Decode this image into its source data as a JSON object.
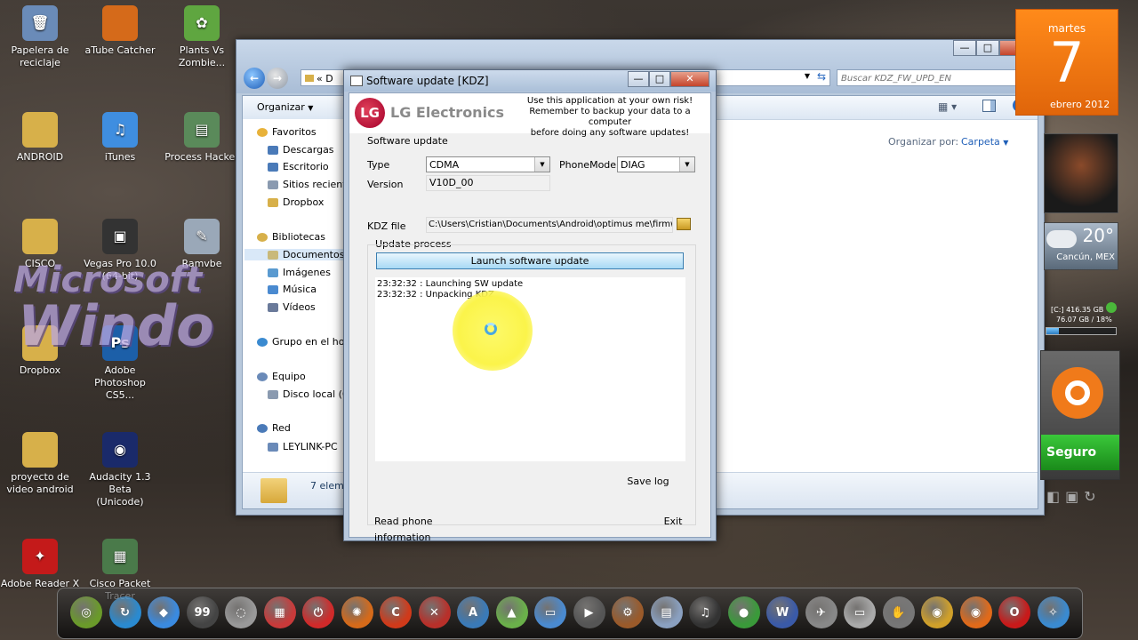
{
  "desktop": {
    "icons": [
      {
        "label": "Papelera de\nreciclaje",
        "glyph": "🗑",
        "color": "#6a8bb8"
      },
      {
        "label": "aTube Catcher",
        "glyph": "",
        "color": "#d56a1a"
      },
      {
        "label": "Plants Vs\nZombie...",
        "glyph": "✿",
        "color": "#5fa640"
      },
      {
        "label": "ANDROID",
        "glyph": "",
        "color": "#d7b04a"
      },
      {
        "label": "iTunes",
        "glyph": "♫",
        "color": "#3f8ee0"
      },
      {
        "label": "Process Hacker",
        "glyph": "▤",
        "color": "#5a8a5a"
      },
      {
        "label": "CISCO",
        "glyph": "",
        "color": "#d7b04a"
      },
      {
        "label": "Vegas Pro 10.0\n(64-bit)",
        "glyph": "▣",
        "color": "#333"
      },
      {
        "label": "Ramvbe",
        "glyph": "✎",
        "color": "#9aa8b8"
      },
      {
        "label": "Dropbox",
        "glyph": "",
        "color": "#d7b04a"
      },
      {
        "label": "Adobe\nPhotoshop CS5...",
        "glyph": "Ps",
        "color": "#1c5fa8"
      },
      {
        "label": "proyecto de\nvideo android",
        "glyph": "",
        "color": "#d7b04a"
      },
      {
        "label": "Audacity 1.3 Beta\n(Unicode)",
        "glyph": "◉",
        "color": "#1a2a6a"
      },
      {
        "label": "Adobe Reader X",
        "glyph": "✦",
        "color": "#c41a1a"
      },
      {
        "label": "Cisco Packet\nTracer",
        "glyph": "▦",
        "color": "#4a7a4a"
      }
    ],
    "watermark_1": "Microsoft",
    "watermark_2": "Windo"
  },
  "explorer": {
    "address_crumb": "« D",
    "search_placeholder": "Buscar KDZ_FW_UPD_EN",
    "organize_label": "Organizar",
    "organize_by_label": "Organizar por:",
    "organize_by_value": "Carpeta",
    "nav_items": [
      {
        "label": "Favoritos",
        "group": true,
        "color": "#e8b23a"
      },
      {
        "label": "Descargas",
        "group": false,
        "color": "#4a7ab8"
      },
      {
        "label": "Escritorio",
        "group": false,
        "color": "#4a7ab8"
      },
      {
        "label": "Sitios reciente",
        "group": false,
        "color": "#8a9ab0"
      },
      {
        "label": "Dropbox",
        "group": false,
        "color": "#d7b04a"
      },
      {
        "label": "Bibliotecas",
        "group": true,
        "color": "#d7b04a"
      },
      {
        "label": "Documentos",
        "group": false,
        "color": "#c9b97a",
        "selected": true
      },
      {
        "label": "Imágenes",
        "group": false,
        "color": "#5a9ad0"
      },
      {
        "label": "Música",
        "group": false,
        "color": "#4a8ad0"
      },
      {
        "label": "Vídeos",
        "group": false,
        "color": "#6a7a9a"
      },
      {
        "label": "Grupo en el ho",
        "group": true,
        "color": "#3a8ad0"
      },
      {
        "label": "Equipo",
        "group": true,
        "color": "#6a8ab8"
      },
      {
        "label": "Disco local (C",
        "group": false,
        "color": "#8a9ab0"
      },
      {
        "label": "Red",
        "group": true,
        "color": "#4a7ab8"
      },
      {
        "label": "LEYLINK-PC",
        "group": false,
        "color": "#6a8ab8"
      }
    ],
    "status_text": "7 elem"
  },
  "dialog": {
    "title": "Software update [KDZ]",
    "brand": "LG Electronics",
    "notice": "Use this application at your own risk!\nRemember to backup your data to a computer\nbefore doing any software updates!",
    "group_software_update": "Software update",
    "type_label": "Type",
    "type_value": "CDMA",
    "phonemode_label": "PhoneMode",
    "phonemode_value": "DIAG",
    "version_label": "Version",
    "version_value": "V10D_00",
    "kdz_label": "KDZ file",
    "kdz_value": "C:\\Users\\Cristian\\Documents\\Android\\optimus me\\firmware\\V",
    "group_update_process": "Update process",
    "launch_button": "Launch software update",
    "log_lines": [
      "23:32:32 : Launching SW update",
      "23:32:32 : Unpacking KDZ"
    ],
    "save_log": "Save log",
    "read_phone": "Read phone information",
    "exit": "Exit"
  },
  "gadgets": {
    "calendar_day_name": "martes",
    "calendar_day": "7",
    "calendar_month_year": "ebrero 2012",
    "weather_temp": "20°",
    "weather_city": "Cancún, MEX",
    "disk_line_1": "[C:] 416.35 GB",
    "disk_line_2": "76.07 GB / 18%",
    "disk_percent": 18,
    "antivirus_status": "Seguro"
  },
  "dock_icons": [
    {
      "name": "globe",
      "color": "#6a9a2a",
      "glyph": "◎"
    },
    {
      "name": "refresh",
      "color": "#2a8ad0",
      "glyph": "↻"
    },
    {
      "name": "dropbox",
      "color": "#3a8ae0",
      "glyph": "◆"
    },
    {
      "name": "monitor",
      "color": "#444",
      "glyph": "99"
    },
    {
      "name": "disc",
      "color": "#999",
      "glyph": "◌"
    },
    {
      "name": "grid",
      "color": "#c83a3a",
      "glyph": "▦"
    },
    {
      "name": "power",
      "color": "#d02a2a",
      "glyph": "⏻"
    },
    {
      "name": "atube",
      "color": "#d56a1a",
      "glyph": "✺"
    },
    {
      "name": "ccleaner",
      "color": "#d03a1a",
      "glyph": "C"
    },
    {
      "name": "tools",
      "color": "#b8302a",
      "glyph": "✕"
    },
    {
      "name": "arch",
      "color": "#3a7ab8",
      "glyph": "A"
    },
    {
      "name": "image",
      "color": "#6ab04a",
      "glyph": "▲"
    },
    {
      "name": "window",
      "color": "#4a8ad0",
      "glyph": "▭"
    },
    {
      "name": "camera",
      "color": "#555",
      "glyph": "▶"
    },
    {
      "name": "gear",
      "color": "#9a5a2a",
      "glyph": "⚙"
    },
    {
      "name": "doc",
      "color": "#8aa0c0",
      "glyph": "▤"
    },
    {
      "name": "headphones",
      "color": "#333",
      "glyph": "♫"
    },
    {
      "name": "mushroom",
      "color": "#3a9a3a",
      "glyph": "●"
    },
    {
      "name": "wow",
      "color": "#3a5aa8",
      "glyph": "W"
    },
    {
      "name": "plane",
      "color": "#888",
      "glyph": "✈"
    },
    {
      "name": "imac",
      "color": "#aaa",
      "glyph": "▭"
    },
    {
      "name": "hand",
      "color": "#777",
      "glyph": "✋"
    },
    {
      "name": "chrome",
      "color": "#d0a02a",
      "glyph": "◉"
    },
    {
      "name": "firefox",
      "color": "#e06a1a",
      "glyph": "◉"
    },
    {
      "name": "opera",
      "color": "#c81a1a",
      "glyph": "O"
    },
    {
      "name": "safari",
      "color": "#3a8ad0",
      "glyph": "✧"
    }
  ]
}
